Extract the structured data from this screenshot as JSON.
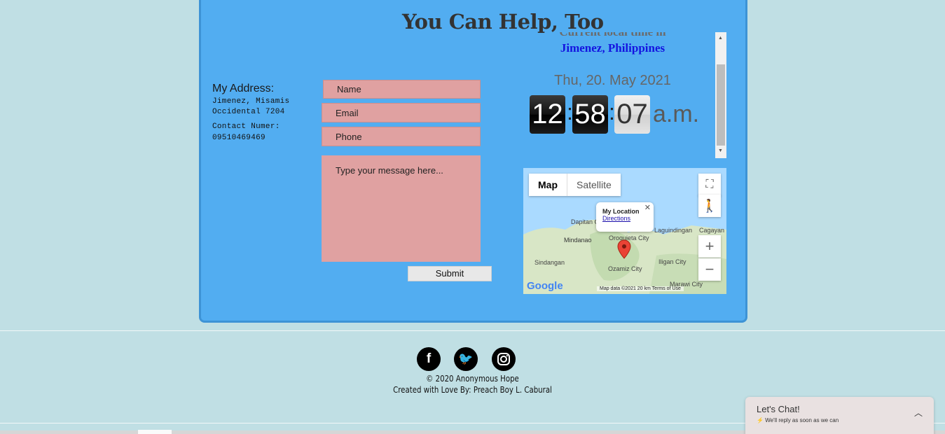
{
  "heading": "You Can Help, Too",
  "address": {
    "label": "My Address:",
    "line1": "Jimenez, Misamis",
    "line2": "Occidental 7204",
    "contact_label": "Contact Numer:",
    "contact_number": "09510469469"
  },
  "form": {
    "name_placeholder": "Name",
    "email_placeholder": "Email",
    "phone_placeholder": "Phone",
    "message_placeholder": "Type your message here...",
    "submit_label": "Submit"
  },
  "clock": {
    "current_label": "Current local time in",
    "location": "Jimenez, Philippines",
    "date": "Thu, 20. May 2021",
    "hours": "12",
    "minutes": "58",
    "seconds": "07",
    "ampm": "a.m."
  },
  "map": {
    "tab_map": "Map",
    "tab_satellite": "Satellite",
    "popup_title": "My Location",
    "popup_link": "Directions",
    "places": [
      "Dapitan City",
      "Oroquieta City",
      "Mindanao",
      "Laguindingan",
      "Cagayan",
      "Sindangan",
      "Ozamiz City",
      "Iligan City",
      "Marawi City"
    ],
    "google": "Google",
    "footer": "Map data ©2021   20 km        Terms of Use",
    "zoom_in": "+",
    "zoom_out": "−"
  },
  "footer": {
    "social_icons": [
      "facebook-icon",
      "twitter-icon",
      "instagram-icon"
    ],
    "copyright": "© 2020 Anonymous Hope",
    "credit": "Created with Love By: Preach Boy L. Cabural"
  },
  "chat": {
    "title": "Let's Chat!",
    "subtitle": "We'll reply as soon as we can"
  },
  "colors": {
    "panel": "#52adf1",
    "field": "#e0a1a1",
    "background": "#c0dfe4"
  }
}
